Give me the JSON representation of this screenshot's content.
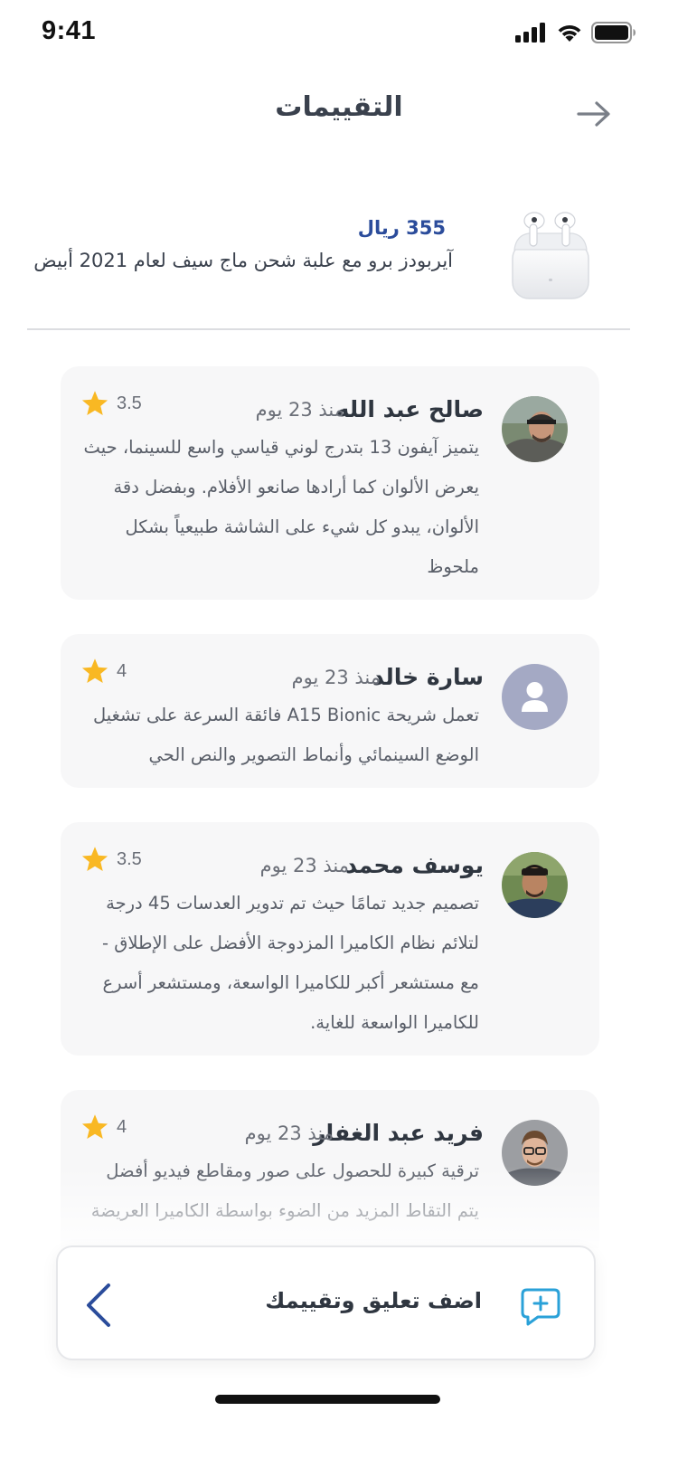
{
  "status_bar": {
    "time": "9:41"
  },
  "header": {
    "title": "التقييمات"
  },
  "product": {
    "price": "355 ريال",
    "name": "آيربودز برو مع علبة شحن ماج سيف لعام 2021 أبيض"
  },
  "reviews": [
    {
      "name": "صالح عبد الله",
      "date": "منذ 23 يوم",
      "rating": "3.5",
      "text": "يتميز آيفون 13 بتدرج لوني قياسي واسع للسينما، حيث يعرض الألوان كما أرادها صانعو الأفلام. وبفضل دقة الألوان، يبدو كل شيء على الشاشة طبيعياً بشكل ملحوظ"
    },
    {
      "name": "سارة خالد",
      "date": "منذ 23 يوم",
      "rating": "4",
      "text": "تعمل شريحة A15 Bionic فائقة السرعة على تشغيل الوضع السينمائي وأنماط التصوير والنص الحي"
    },
    {
      "name": "يوسف محمد",
      "date": "منذ 23 يوم",
      "rating": "3.5",
      "text": "تصميم جديد تمامًا حيث تم تدوير العدسات 45 درجة لتلائم نظام الكاميرا المزدوجة الأفضل على الإطلاق - مع مستشعر أكبر للكاميرا الواسعة، ومستشعر أسرع للكاميرا الواسعة للغاية."
    },
    {
      "name": "فريد عبد الغفار",
      "date": "منذ 23 يوم",
      "rating": "4",
      "text": "ترقية كبيرة للحصول على صور ومقاطع فيديو أفضل يتم التقاط المزيد من الضوء بواسطة الكاميرا العريضة"
    }
  ],
  "add_review": {
    "label": "اضف تعليق وتقييمك"
  },
  "colors": {
    "accent": "#2b4c9b",
    "star": "#f9b823",
    "chat_icon": "#2aa1d8",
    "card_bg": "#f7f7f8"
  },
  "icons": [
    "signal-icon",
    "wifi-icon",
    "battery-icon",
    "arrow-right-icon",
    "star-icon",
    "user-placeholder-icon",
    "add-comment-icon",
    "chevron-left-icon"
  ]
}
